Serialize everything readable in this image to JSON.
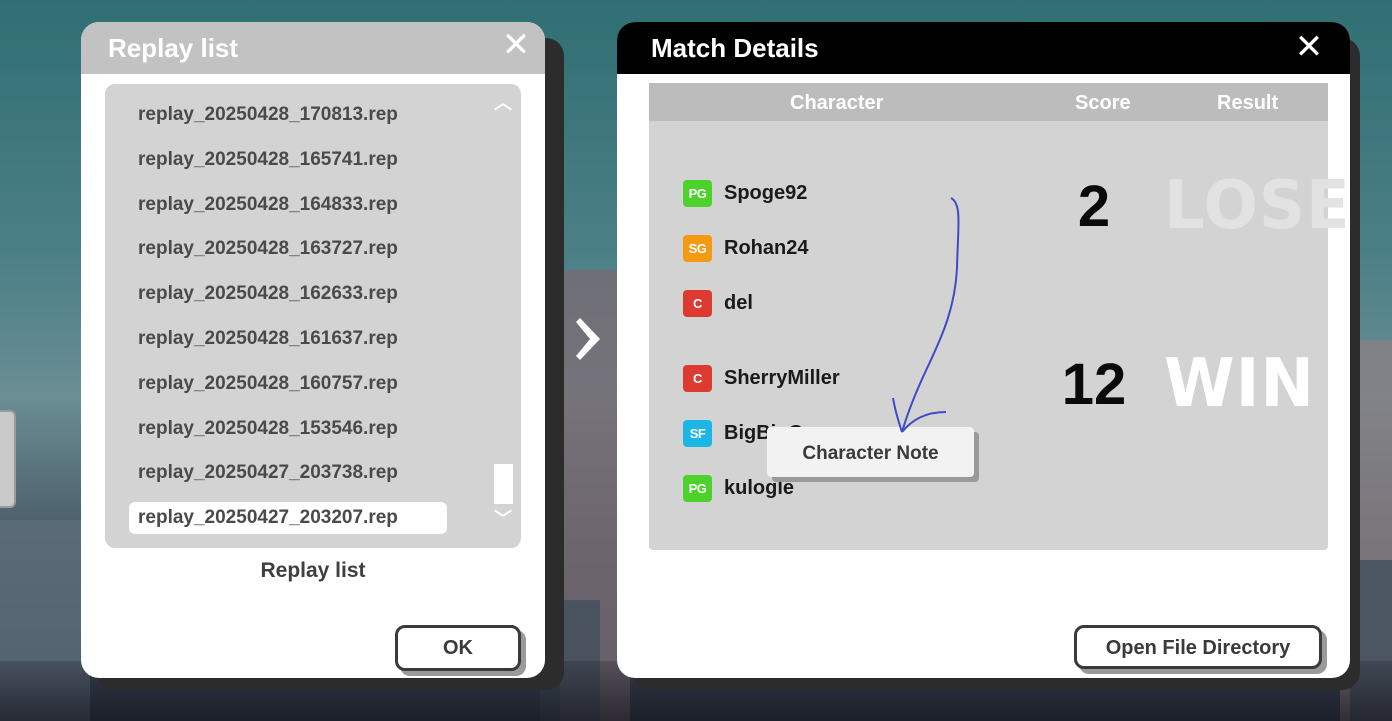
{
  "replay_panel": {
    "title": "Replay list",
    "items": [
      "replay_20250428_170813.rep",
      "replay_20250428_165741.rep",
      "replay_20250428_164833.rep",
      "replay_20250428_163727.rep",
      "replay_20250428_162633.rep",
      "replay_20250428_161637.rep",
      "replay_20250428_160757.rep",
      "replay_20250428_153546.rep",
      "replay_20250427_203738.rep",
      "replay_20250427_203207.rep"
    ],
    "selected_index": 9,
    "caption": "Replay list",
    "ok_label": "OK"
  },
  "match_panel": {
    "title": "Match Details",
    "columns": {
      "character": "Character",
      "score": "Score",
      "result": "Result"
    },
    "teams": [
      {
        "players": [
          {
            "badge": "PG",
            "name": "Spoge92",
            "color": "#4cd22a"
          },
          {
            "badge": "SG",
            "name": "Rohan24",
            "color": "#f39a12"
          },
          {
            "badge": "C",
            "name": "del",
            "color": "#dd3a32"
          }
        ],
        "score": "2",
        "result": "LOSE"
      },
      {
        "players": [
          {
            "badge": "C",
            "name": "SherryMiller",
            "color": "#dd3a32"
          },
          {
            "badge": "SF",
            "name": "BigBigC",
            "color": "#1cb6e6"
          },
          {
            "badge": "PG",
            "name": "kulogle",
            "color": "#4cd22a"
          }
        ],
        "score": "12",
        "result": "WIN"
      }
    ],
    "tooltip": "Character Note",
    "open_dir_label": "Open File Directory"
  },
  "icons": {
    "close": "close-icon",
    "scroll_up": "chevron-up-icon",
    "scroll_down": "chevron-down-icon",
    "arrow": "chevron-right-icon"
  }
}
